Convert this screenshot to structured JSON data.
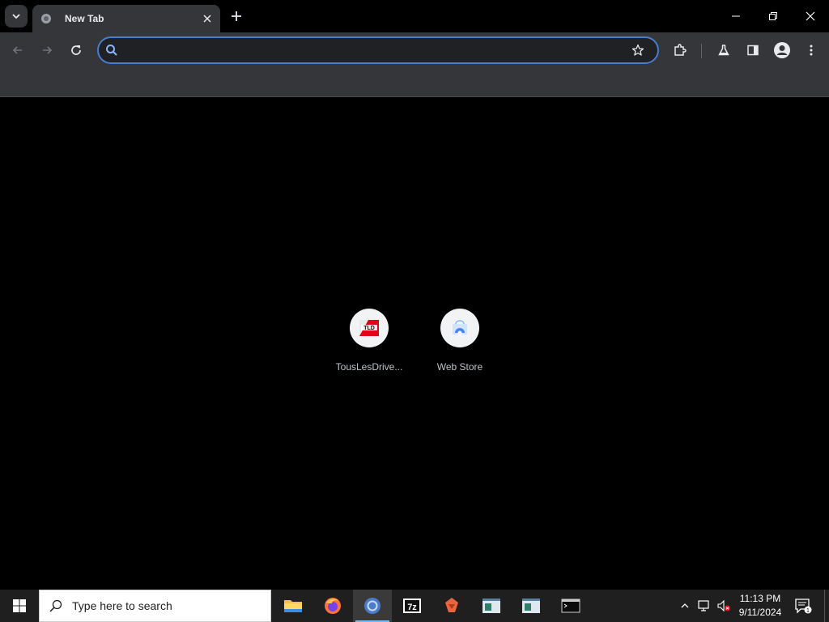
{
  "browser": {
    "tab": {
      "title": "New Tab"
    },
    "omnibox": {
      "value": "",
      "placeholder": ""
    },
    "accent_color": "#4a7ccc"
  },
  "new_tab_page": {
    "shortcuts": [
      {
        "label": "TousLesDrive...",
        "icon": "tld-favicon-icon"
      },
      {
        "label": "Web Store",
        "icon": "web-store-icon"
      }
    ]
  },
  "taskbar": {
    "search_placeholder": "Type here to search",
    "apps": [
      {
        "name": "file-explorer",
        "icon": "folder-icon"
      },
      {
        "name": "firefox",
        "icon": "firefox-icon"
      },
      {
        "name": "chrome",
        "icon": "chrome-icon",
        "active": true
      },
      {
        "name": "7zip",
        "icon": "7zip-icon",
        "label": "7z"
      },
      {
        "name": "app",
        "icon": "app-icon"
      },
      {
        "name": "window-app-1",
        "icon": "window-icon"
      },
      {
        "name": "window-app-2",
        "icon": "window-icon"
      },
      {
        "name": "terminal",
        "icon": "terminal-icon"
      }
    ],
    "clock": {
      "time": "11:13 PM",
      "date": "9/11/2024"
    },
    "notification_count": "1"
  }
}
